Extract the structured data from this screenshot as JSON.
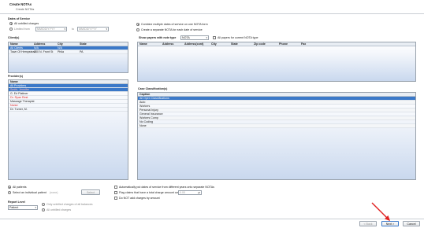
{
  "window": {
    "title": "Create NOTAs",
    "subtitle": "Create NOTAs"
  },
  "dates_of_service": {
    "heading": "Dates of Service",
    "option_all_label": "All unbilled charges",
    "option_limited_label": "Limited from",
    "from_value": "MM/DD/YYYY",
    "to_label": "to",
    "to_value": "MM/DD/YYYY"
  },
  "clients": {
    "heading": "Client(s)",
    "columns": [
      "Name",
      "Address",
      "City",
      "State"
    ],
    "rows": [
      {
        "name": "All Clients",
        "address": "N/A",
        "city": "N/A",
        "state": "",
        "selected": true
      },
      {
        "name": "Town Of Hempstead",
        "address": "200 N. Front St",
        "city": "Phila",
        "state": "PA",
        "selected": false
      }
    ]
  },
  "providers": {
    "heading": "Provider(s)",
    "columns": [
      "Name"
    ],
    "rows": [
      {
        "name": "All Providers",
        "style": "selected"
      },
      {
        "name": "Smith, Jennifer",
        "style": "selected"
      },
      {
        "name": "G. Ed Plattner",
        "style": "normal"
      },
      {
        "name": "Dr. Ryan Rest",
        "style": "red"
      },
      {
        "name": "Massage Therapist",
        "style": "normal"
      },
      {
        "name": "Nurse",
        "style": "red"
      },
      {
        "name": "Dr. Turner, M.",
        "style": "normal"
      }
    ]
  },
  "options": {
    "combine_label": "Combine multiple dates of service on one NOTA form",
    "separate_label": "Create a separate NOTA for each date of service"
  },
  "payers": {
    "show_label": "Show payers with note type",
    "show_value": "NOTA",
    "all_payers_label": "All payers for current NOTA type",
    "columns": [
      "Name",
      "Address",
      "Address(cont)",
      "City",
      "State",
      "Zip code",
      "Phone",
      "Fax"
    ]
  },
  "case_classifications": {
    "heading": "Case Classification(s)",
    "columns": [
      "Caption"
    ],
    "rows": [
      {
        "caption": "All Open Classifications",
        "selected": true
      },
      {
        "caption": "Auto",
        "selected": false
      },
      {
        "caption": "Workers",
        "selected": false
      },
      {
        "caption": "Personal Injury",
        "selected": false
      },
      {
        "caption": "General Insurance",
        "selected": false
      },
      {
        "caption": "Workers Comp",
        "selected": false
      },
      {
        "caption": "No Coding",
        "selected": false
      },
      {
        "caption": "None",
        "selected": false
      }
    ]
  },
  "patients": {
    "all_label": "All patients",
    "select_label": "Select an individual patient",
    "patient_value": "(none)",
    "select_button": "Select"
  },
  "report_level": {
    "heading": "Report Level",
    "value": "Patient",
    "option_unbilled_label": "Only unbilled charges of all balances",
    "option_all_label": "All unbilled charges"
  },
  "checks": {
    "auto_label": "Automatically put dates of service from different years onto separate NOTAs",
    "flag_label": "Flag claims that have a total charge amount over",
    "flag_amount": "0.00",
    "skip_label": "Do NOT add charges by amount"
  },
  "footer": {
    "back": "< Back",
    "next": "Next >",
    "cancel": "Cancel"
  }
}
